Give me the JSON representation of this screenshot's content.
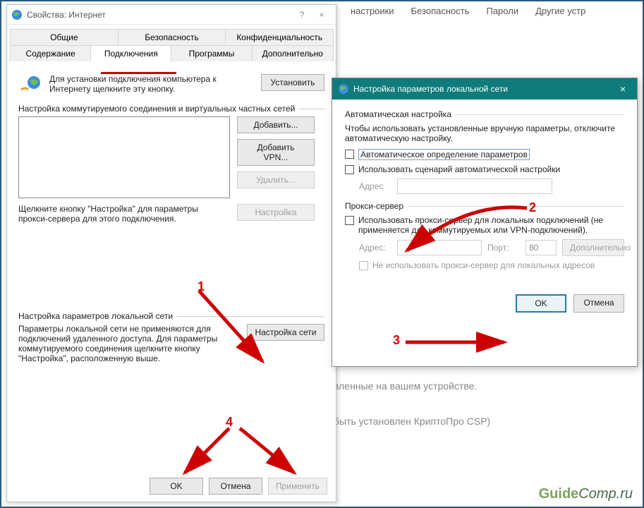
{
  "bg": {
    "tabs": [
      "настроики",
      "Безопасность",
      "Пароли",
      "Другие устр"
    ],
    "line1": "вленные на вашем устройстве.",
    "line2": "быть установлен КриптоПро CSP)"
  },
  "win1": {
    "title": "Свойства: Интернет",
    "help": "?",
    "close": "×",
    "tabs_row1": [
      "Общие",
      "Безопасность",
      "Конфиденциальность"
    ],
    "tabs_row2": [
      "Содержание",
      "Подключения",
      "Программы",
      "Дополнительно"
    ],
    "active_tab": "Подключения",
    "lead_text": "Для установки подключения компьютера к Интернету щелкните эту кнопку.",
    "install_btn": "Установить",
    "dial_label": "Настройка коммутируемого соединения и виртуальных частных сетей",
    "dial_buttons": {
      "add": "Добавить...",
      "add_vpn": "Добавить VPN...",
      "remove": "Удалить...",
      "settings": "Настройка"
    },
    "dial_hint": "Щелкните кнопку \"Настройка\" для параметры прокси-сервера для этого подключения.",
    "lan_label": "Настройка параметров локальной сети",
    "lan_text": "Параметры локальной сети не применяются для подключений удаленного доступа. Для параметры коммутируемого соединения щелкните кнопку \"Настройка\", расположенную выше.",
    "lan_btn": "Настройка сети",
    "bottom": {
      "ok": "OK",
      "cancel": "Отмена",
      "apply": "Применить"
    }
  },
  "win2": {
    "title": "Настройка параметров локальной сети",
    "close": "×",
    "auto_label": "Автоматическая настройка",
    "auto_text": "Чтобы использовать установленные вручную параметры, отключите автоматическую настройку.",
    "chk_auto_detect": "Автоматическое определение параметров",
    "chk_use_script": "Использовать сценарий автоматической настройки",
    "addr_label": "Адрес",
    "proxy_label": "Прокси-сервер",
    "chk_use_proxy": "Использовать прокси-сервер для локальных подключений (не применяется для коммутируемых или VPN-подключений).",
    "proxy_addr": "Адрес:",
    "proxy_port": "Порт:",
    "proxy_port_val": "80",
    "advanced": "Дополнительно",
    "chk_bypass": "Не использовать прокси-сервер для локальных адресов",
    "ok": "OK",
    "cancel": "Отмена"
  },
  "anno": {
    "n1": "1",
    "n2": "2",
    "n3": "3",
    "n4": "4"
  },
  "watermark": {
    "a": "Guide",
    "b": "Comp",
    "c": ".ru"
  }
}
